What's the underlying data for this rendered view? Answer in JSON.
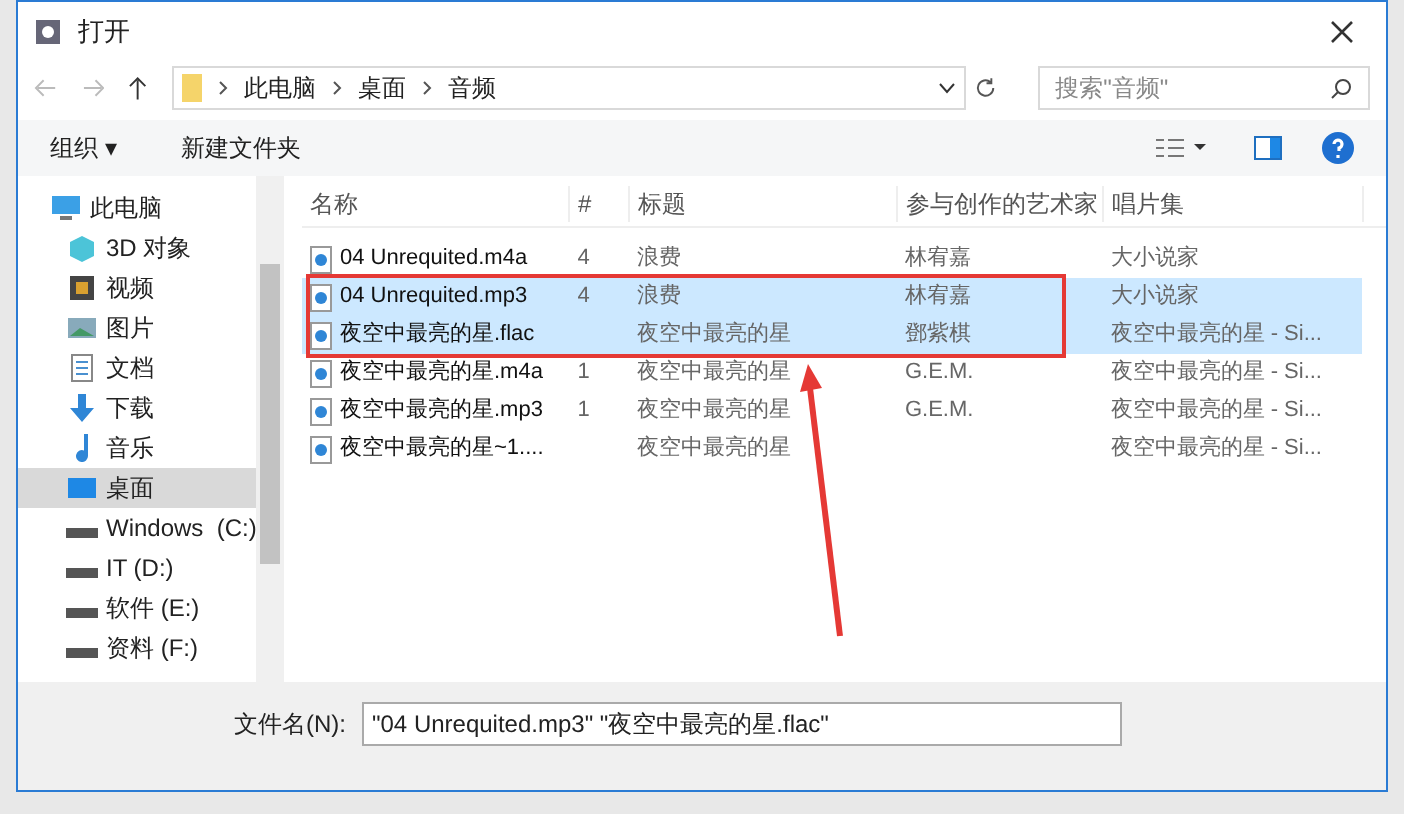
{
  "window": {
    "title": "打开"
  },
  "address": {
    "crumbs": [
      "此电脑",
      "桌面",
      "音频"
    ]
  },
  "search": {
    "placeholder": "搜索\"音频\""
  },
  "toolbar": {
    "organize": "组织 ▾",
    "new_folder": "新建文件夹"
  },
  "sidebar": {
    "items": [
      {
        "label": "此电脑",
        "kind": "pc",
        "selected": false
      },
      {
        "label": "3D 对象",
        "kind": "cube",
        "selected": false
      },
      {
        "label": "视频",
        "kind": "video",
        "selected": false
      },
      {
        "label": "图片",
        "kind": "picture",
        "selected": false
      },
      {
        "label": "文档",
        "kind": "doc",
        "selected": false
      },
      {
        "label": "下载",
        "kind": "download",
        "selected": false
      },
      {
        "label": "音乐",
        "kind": "music",
        "selected": false
      },
      {
        "label": "桌面",
        "kind": "desktop",
        "selected": true
      },
      {
        "label": "Windows  (C:)",
        "kind": "drive",
        "selected": false
      },
      {
        "label": "IT (D:)",
        "kind": "drive",
        "selected": false
      },
      {
        "label": "软件 (E:)",
        "kind": "drive",
        "selected": false
      },
      {
        "label": "资料 (F:)",
        "kind": "drive",
        "selected": false
      }
    ]
  },
  "table": {
    "columns": [
      "名称",
      "#",
      "标题",
      "参与创作的艺术家",
      "唱片集"
    ],
    "rows": [
      {
        "name": "04 Unrequited.m4a",
        "number": "4",
        "title": "浪费",
        "artist": "林宥嘉",
        "album": "大小说家",
        "selected": false
      },
      {
        "name": "04 Unrequited.mp3",
        "number": "4",
        "title": "浪费",
        "artist": "林宥嘉",
        "album": "大小说家",
        "selected": true
      },
      {
        "name": "夜空中最亮的星.flac",
        "title": "夜空中最亮的星",
        "artist": "鄧紫棋",
        "album": "夜空中最亮的星 - Si...",
        "selected": true
      },
      {
        "name": "夜空中最亮的星.m4a",
        "number": "1",
        "title": "夜空中最亮的星",
        "artist": "G.E.M.",
        "album": "夜空中最亮的星 - Si...",
        "selected": false
      },
      {
        "name": "夜空中最亮的星.mp3",
        "number": "1",
        "title": "夜空中最亮的星",
        "artist": "G.E.M.",
        "album": "夜空中最亮的星 - Si...",
        "selected": false
      },
      {
        "name": "夜空中最亮的星~1....",
        "title": "夜空中最亮的星",
        "album": "夜空中最亮的星 - Si...",
        "selected": false
      }
    ]
  },
  "filename": {
    "label": "文件名(N):",
    "value": "\"04 Unrequited.mp3\" \"夜空中最亮的星.flac\""
  }
}
